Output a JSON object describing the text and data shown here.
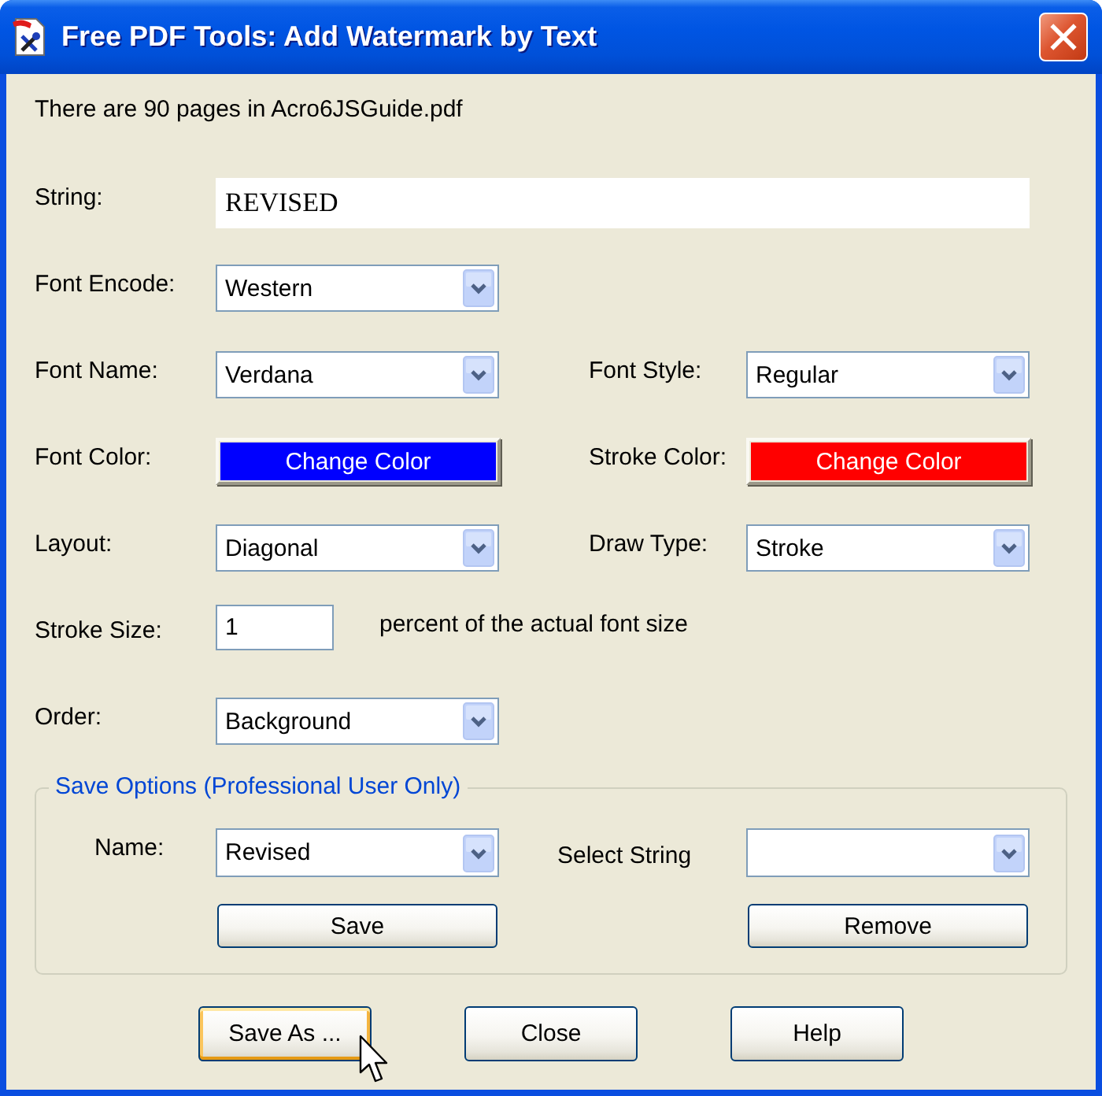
{
  "window": {
    "title": "Free PDF Tools: Add Watermark by Text"
  },
  "info": "There are 90 pages in Acro6JSGuide.pdf",
  "rows": [
    {
      "fields": [
        {
          "kind": "text",
          "label": "String:",
          "value": "REVISED"
        }
      ]
    },
    {
      "fields": [
        {
          "kind": "dropdown",
          "label": "Font Encode:",
          "value": "Western"
        }
      ]
    },
    {
      "fields": [
        {
          "kind": "dropdown",
          "label": "Font Name:",
          "value": "Verdana"
        },
        {
          "kind": "dropdown",
          "label": "Font Style:",
          "value": "Regular"
        }
      ]
    },
    {
      "fields": [
        {
          "kind": "color_button",
          "label": "Font Color:",
          "button": "Change Color",
          "color": "#0000ff"
        },
        {
          "kind": "color_button",
          "label": "Stroke Color:",
          "button": "Change Color",
          "color": "#ff0000"
        }
      ]
    },
    {
      "fields": [
        {
          "kind": "dropdown",
          "label": "Layout:",
          "value": "Diagonal"
        },
        {
          "kind": "dropdown",
          "label": "Draw Type:",
          "value": "Stroke"
        }
      ]
    },
    {
      "fields": [
        {
          "kind": "number",
          "label": "Stroke Size:",
          "value": "1",
          "note": "percent of the actual font size"
        }
      ]
    },
    {
      "fields": [
        {
          "kind": "dropdown",
          "label": "Order:",
          "value": "Background"
        }
      ]
    }
  ],
  "save_options": {
    "title": "Save Options (Professional User Only)",
    "name": {
      "label": "Name:",
      "value": "Revised"
    },
    "select_string": {
      "label": "Select String"
    },
    "buttons": [
      "Save",
      "Remove"
    ]
  },
  "buttons": [
    {
      "label": "Save As ...",
      "hovered": true
    },
    {
      "label": "Close",
      "hovered": false
    },
    {
      "label": "Help",
      "hovered": false
    }
  ]
}
